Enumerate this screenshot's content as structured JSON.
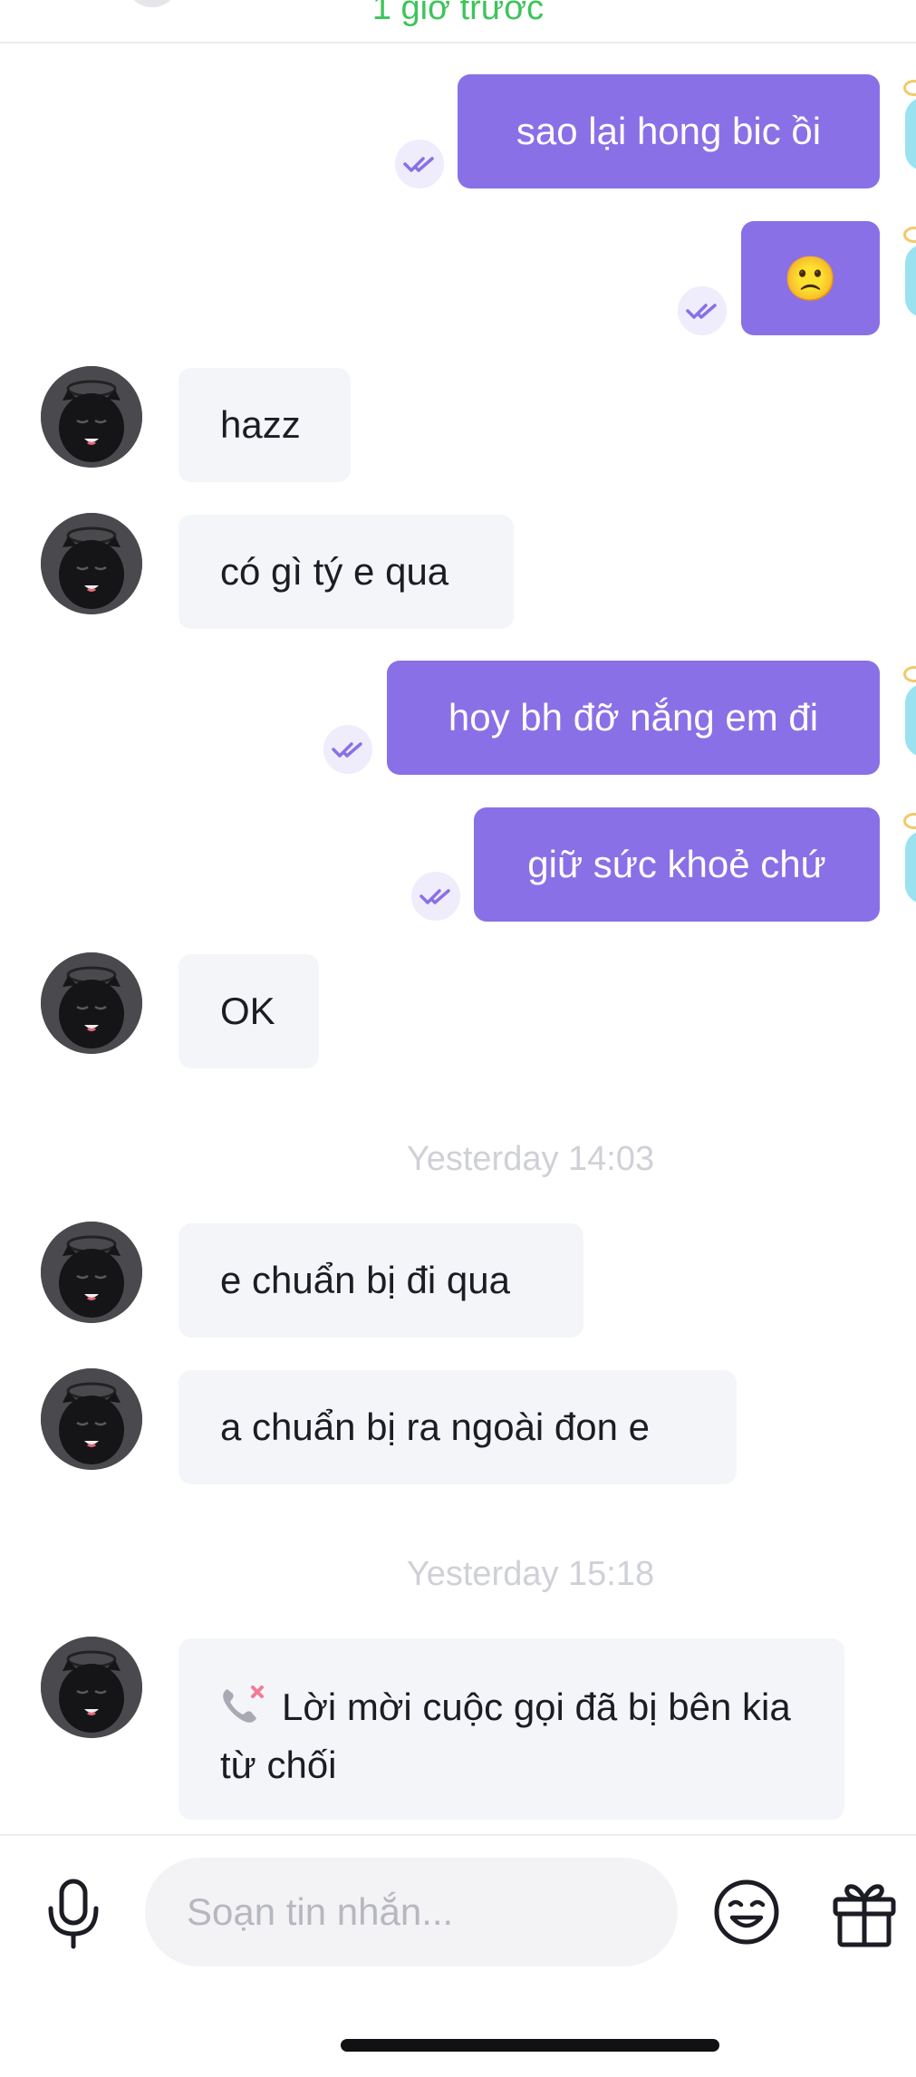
{
  "header": {
    "status": "1 giờ trước"
  },
  "messages": [
    {
      "direction": "out",
      "text": "sao lại hong bic ồi",
      "read": true
    },
    {
      "direction": "out",
      "text": "🙁",
      "read": true
    },
    {
      "direction": "in",
      "text": "hazz"
    },
    {
      "direction": "in",
      "text": "có gì tý e qua"
    },
    {
      "direction": "out",
      "text": "hoy bh đỡ nắng em đi",
      "read": true
    },
    {
      "direction": "out",
      "text": "giữ sức khoẻ chứ",
      "read": true
    },
    {
      "direction": "in",
      "text": "OK"
    }
  ],
  "timestamps": [
    "Yesterday 14:03",
    "Yesterday 15:18"
  ],
  "messages_2": [
    {
      "direction": "in",
      "text": "e chuẩn bị đi qua"
    },
    {
      "direction": "in",
      "text": "a chuẩn bị ra ngoài đon e"
    }
  ],
  "call_message": {
    "text": "Lời mời cuộc gọi đã bị bên kia từ chối",
    "icon": "declined-call-icon"
  },
  "composer": {
    "placeholder": "Soạn tin nhắn...",
    "mic_icon": "microphone-icon",
    "emoji_icon": "emoji-icon",
    "gift_icon": "gift-icon"
  },
  "colors": {
    "outgoing_bubble": "#8a70e6",
    "incoming_bubble": "#f4f5f8",
    "status_green": "#3ec45a",
    "read_tick": "#8a70e6"
  }
}
